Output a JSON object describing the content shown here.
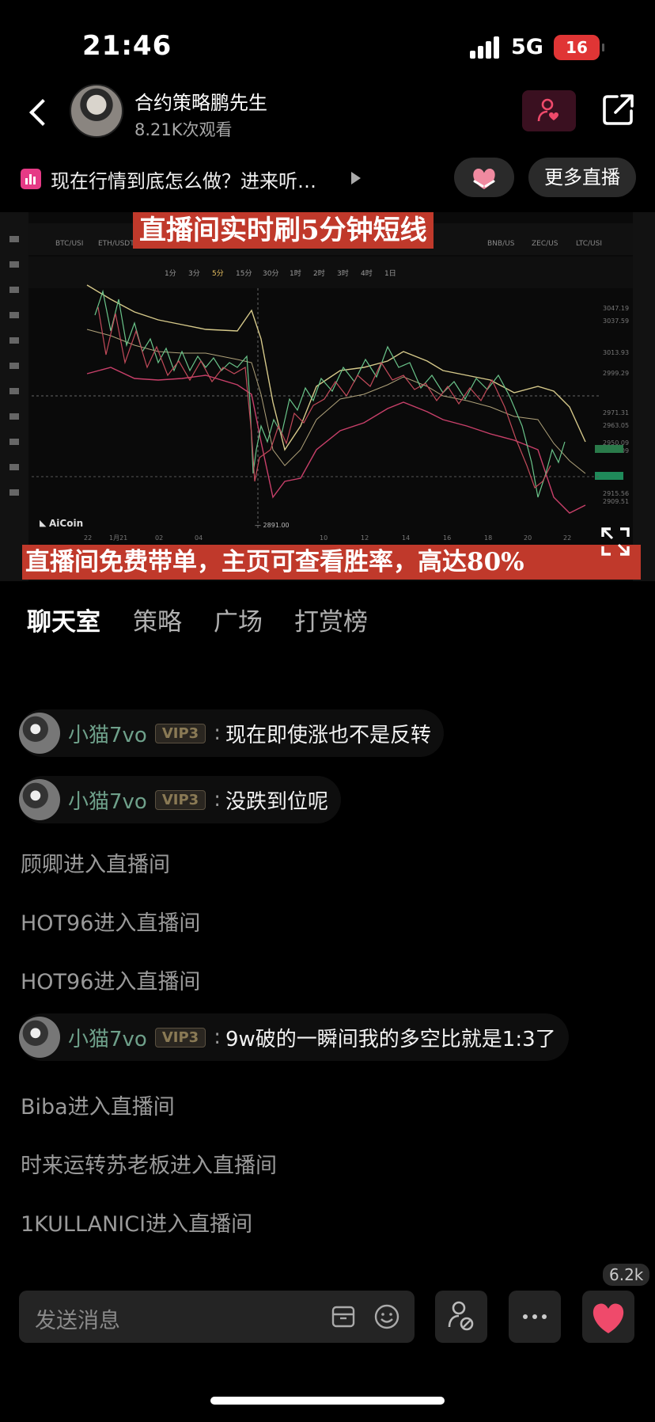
{
  "status_bar": {
    "time": "21:46",
    "network": "5G",
    "battery": "16"
  },
  "header": {
    "host_name": "合约策略鹏先生",
    "viewers": "8.21K次观看"
  },
  "topic": {
    "text": "现在行情到底怎么做？进来听…",
    "more_live": "更多直播"
  },
  "video": {
    "banner_top": "直播间实时刷5分钟短线",
    "banner_bottom": "直播间免费带单，主页可查看胜率，高达80%",
    "watermark": "AiCoin",
    "low_marker": "2891.00"
  },
  "tabs": [
    {
      "label": "聊天室",
      "active": true
    },
    {
      "label": "策略",
      "active": false
    },
    {
      "label": "广场",
      "active": false
    },
    {
      "label": "打赏榜",
      "active": false
    }
  ],
  "chat": {
    "messages": [
      {
        "type": "message",
        "user": "小猫7vo",
        "badge": "VIP3",
        "text": "现在即使涨也不是反转"
      },
      {
        "type": "message",
        "user": "小猫7vo",
        "badge": "VIP3",
        "text": "没跌到位呢"
      },
      {
        "type": "enter",
        "text": "顾卿进入直播间"
      },
      {
        "type": "enter",
        "text": "HOT96进入直播间"
      },
      {
        "type": "enter",
        "text": "HOT96进入直播间"
      },
      {
        "type": "message",
        "user": "小猫7vo",
        "badge": "VIP3",
        "text": "9w破的一瞬间我的多空比就是1:3了"
      },
      {
        "type": "enter",
        "text": "Biba进入直播间"
      },
      {
        "type": "enter",
        "text": "时来运转苏老板进入直播间"
      },
      {
        "type": "enter",
        "text": "1KULLANICI进入直播间"
      }
    ]
  },
  "bottom_bar": {
    "placeholder": "发送消息",
    "like_count": "6.2k"
  },
  "colors": {
    "accent_red": "#c0392b",
    "vip_gold": "#8a7a55",
    "username_green": "#6ea08a",
    "heart_pink": "#ef4a6b"
  }
}
